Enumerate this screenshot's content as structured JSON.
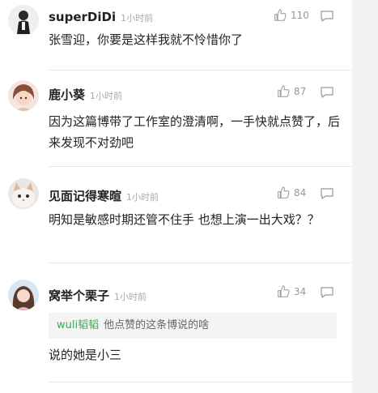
{
  "comments": [
    {
      "name": "superDiDi",
      "time": "1小时前",
      "likes": "110",
      "text": "张雪迎，你要是这样我就不怜惜你了"
    },
    {
      "name": "鹿小葵",
      "time": "1小时前",
      "likes": "87",
      "text": "因为这篇博带了工作室的澄清啊，一手快就点赞了，后来发现不对劲吧"
    },
    {
      "name": "见面记得寒暄",
      "time": "1小时前",
      "likes": "84",
      "text": "明知是敏感时期还管不住手 也想上演一出大戏？？"
    },
    {
      "name": "窝举个栗子",
      "time": "1小时前",
      "likes": "34",
      "quote_name": "wuli韬韬",
      "quote_text": "他点赞的这条博说的啥",
      "text": "说的她是小三"
    }
  ],
  "colors": {
    "quote_name": "#44a25a",
    "time": "#aaaaaa",
    "icon": "#999999"
  }
}
